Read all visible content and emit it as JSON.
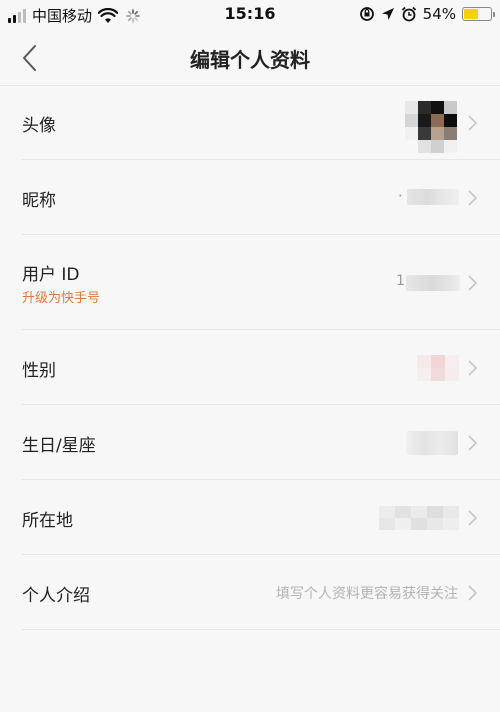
{
  "status_bar": {
    "carrier": "中国移动",
    "time": "15:16",
    "battery_percent": "54%",
    "battery_level": 0.54,
    "icons": [
      "signal-icon",
      "wifi-icon",
      "loading-icon",
      "orientation-lock-icon",
      "location-icon",
      "alarm-icon",
      "battery-icon"
    ]
  },
  "nav": {
    "title": "编辑个人资料",
    "back_icon": "chevron-left-icon"
  },
  "rows": {
    "avatar": {
      "label": "头像"
    },
    "nickname": {
      "label": "昵称",
      "value_hint": "·"
    },
    "user_id": {
      "label": "用户 ID",
      "sub": "升级为快手号",
      "value_hint": "1"
    },
    "gender": {
      "label": "性别"
    },
    "birthday": {
      "label": "生日/星座"
    },
    "location": {
      "label": "所在地"
    },
    "intro": {
      "label": "个人介绍",
      "placeholder": "填写个人资料更容易获得关注"
    }
  },
  "colors": {
    "background": "#f7f7f7",
    "accent": "#e07a3a",
    "divider": "#e6e6e6",
    "chevron": "#c6c6c6"
  }
}
